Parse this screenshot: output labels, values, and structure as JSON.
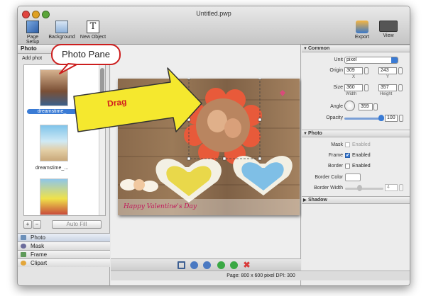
{
  "window": {
    "title": "Untitled.pwp"
  },
  "toolbar": {
    "items": [
      {
        "label": "Page Setup",
        "icon": "page-setup-icon"
      },
      {
        "label": "Background",
        "icon": "background-icon"
      },
      {
        "label": "New Object",
        "icon": "new-object-icon"
      }
    ],
    "right_items": [
      {
        "label": "Export",
        "icon": "export-icon"
      },
      {
        "label": "View",
        "icon": "view-icon"
      }
    ]
  },
  "left_panel": {
    "header": "Photo",
    "add_label": "Add phot",
    "thumbnails": [
      {
        "label": "dreamstime_",
        "selected": true
      },
      {
        "label": "dreamstime_...",
        "selected": false
      },
      {
        "label": "",
        "selected": false
      }
    ],
    "add_button": "+",
    "remove_button": "−",
    "auto_fill": "Auto Fill",
    "tabs": [
      "Photo",
      "Mask",
      "Frame",
      "Clipart"
    ]
  },
  "callout": {
    "text": "Photo Pane"
  },
  "drag_arrow": {
    "text": "Drag"
  },
  "canvas": {
    "banner_text": "Happy Valentine's Day"
  },
  "status_bar": {
    "text": "Page: 800 x 600 pixel DPI: 300"
  },
  "inspector": {
    "common": {
      "header": "Common",
      "unit_label": "Unit",
      "unit_value": "pixel",
      "origin_label": "Origin",
      "origin_x": "309",
      "origin_y": "243",
      "x_label": "X",
      "y_label": "Y",
      "size_label": "Size",
      "width": "360",
      "height": "357",
      "width_label": "Width",
      "height_label": "Height",
      "angle_label": "Angle",
      "angle_value": "359",
      "opacity_label": "Opacity",
      "opacity_value": "100"
    },
    "photo": {
      "header": "Photo",
      "mask_label": "Mask",
      "mask_value": "Enabled",
      "frame_label": "Frame",
      "frame_value": "Enabled",
      "border_label": "Border",
      "border_value": "Enabled",
      "border_color_label": "Border Color",
      "border_width_label": "Border Width",
      "border_width_value": "4"
    },
    "shadow": {
      "header": "Shadow"
    }
  },
  "colors": {
    "accent": "#3a7bd5",
    "callout_border": "#cc1e1e",
    "arrow_fill": "#f5e82e"
  }
}
